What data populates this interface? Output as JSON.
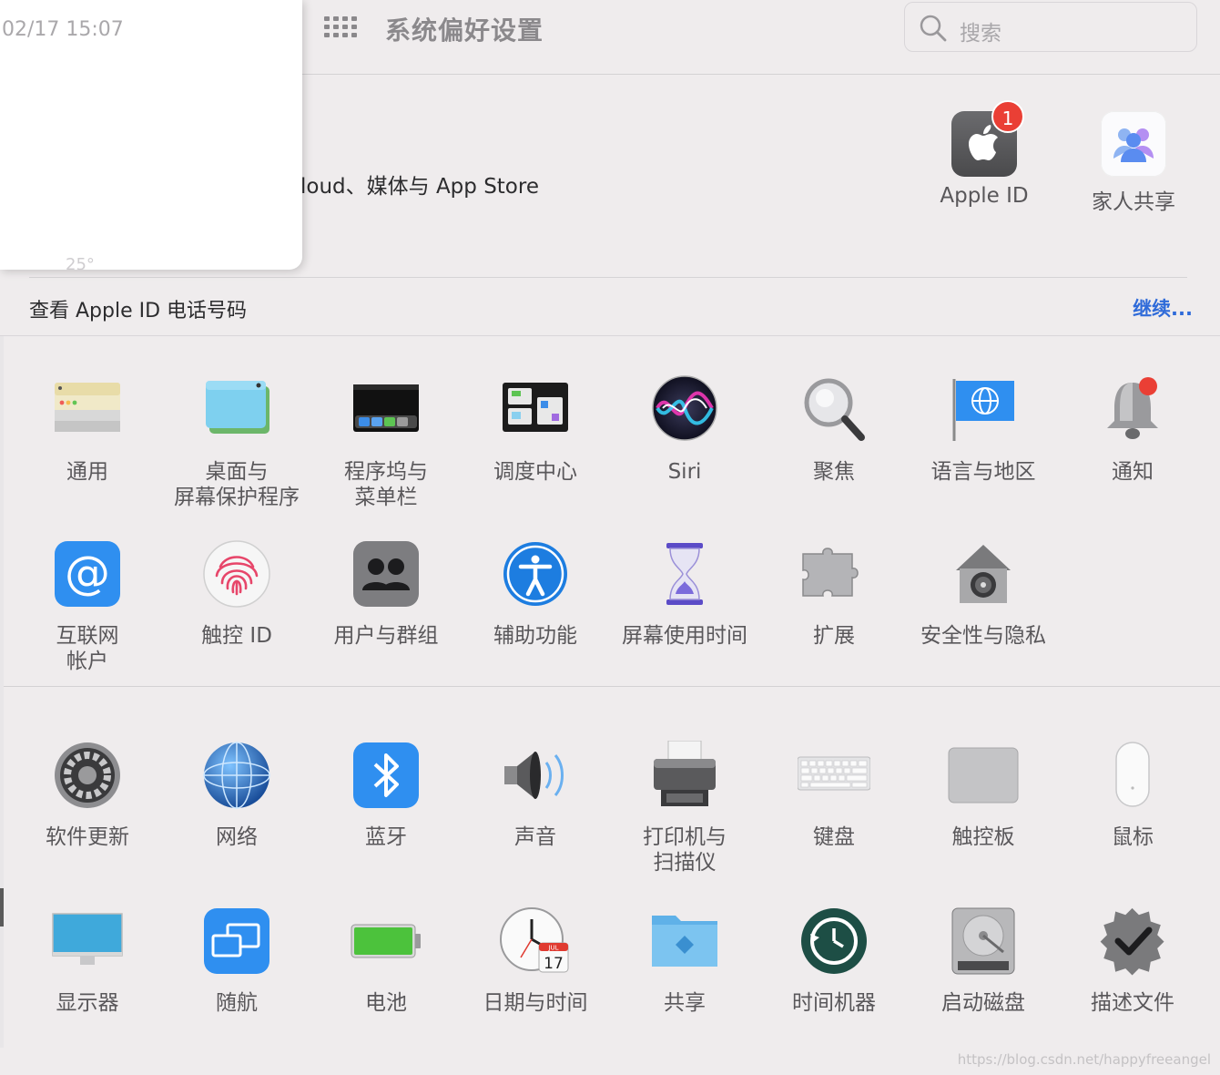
{
  "window": {
    "title": "系统偏好设置"
  },
  "search": {
    "placeholder": "搜索"
  },
  "panel": {
    "time": "02/17 15:07",
    "fragment": "25°"
  },
  "account": {
    "subtitle": "loud、媒体与 App Store"
  },
  "top_items": [
    {
      "label": "Apple ID",
      "icon": "apple-logo-icon",
      "badge": "1"
    },
    {
      "label": "家人共享",
      "icon": "family-sharing-icon"
    }
  ],
  "notice": {
    "text": "查看 Apple ID 电话号码",
    "link": "继续..."
  },
  "section1": [
    {
      "label": "通用",
      "icon": "general-icon"
    },
    {
      "label": "桌面与\n屏幕保护程序",
      "icon": "desktop-screensaver-icon"
    },
    {
      "label": "程序坞与\n菜单栏",
      "icon": "dock-menubar-icon"
    },
    {
      "label": "调度中心",
      "icon": "mission-control-icon"
    },
    {
      "label": "Siri",
      "icon": "siri-icon"
    },
    {
      "label": "聚焦",
      "icon": "spotlight-icon"
    },
    {
      "label": "语言与地区",
      "icon": "language-region-icon"
    },
    {
      "label": "通知",
      "icon": "notifications-icon"
    },
    {
      "label": "互联网\n帐户",
      "icon": "internet-accounts-icon"
    },
    {
      "label": "触控 ID",
      "icon": "touch-id-icon"
    },
    {
      "label": "用户与群组",
      "icon": "users-groups-icon"
    },
    {
      "label": "辅助功能",
      "icon": "accessibility-icon"
    },
    {
      "label": "屏幕使用时间",
      "icon": "screen-time-icon"
    },
    {
      "label": "扩展",
      "icon": "extensions-icon"
    },
    {
      "label": "安全性与隐私",
      "icon": "security-privacy-icon"
    }
  ],
  "section2": [
    {
      "label": "软件更新",
      "icon": "software-update-icon"
    },
    {
      "label": "网络",
      "icon": "network-icon"
    },
    {
      "label": "蓝牙",
      "icon": "bluetooth-icon"
    },
    {
      "label": "声音",
      "icon": "sound-icon"
    },
    {
      "label": "打印机与\n扫描仪",
      "icon": "printers-scanners-icon"
    },
    {
      "label": "键盘",
      "icon": "keyboard-icon"
    },
    {
      "label": "触控板",
      "icon": "trackpad-icon"
    },
    {
      "label": "鼠标",
      "icon": "mouse-icon"
    },
    {
      "label": "显示器",
      "icon": "displays-icon"
    },
    {
      "label": "随航",
      "icon": "sidecar-icon"
    },
    {
      "label": "电池",
      "icon": "battery-icon"
    },
    {
      "label": "日期与时间",
      "icon": "date-time-icon"
    },
    {
      "label": "共享",
      "icon": "sharing-icon"
    },
    {
      "label": "时间机器",
      "icon": "time-machine-icon"
    },
    {
      "label": "启动磁盘",
      "icon": "startup-disk-icon"
    },
    {
      "label": "描述文件",
      "icon": "profiles-icon"
    }
  ],
  "date_icon": {
    "month": "JUL",
    "day": "17"
  },
  "watermark": "https://blog.csdn.net/happyfreeangel"
}
